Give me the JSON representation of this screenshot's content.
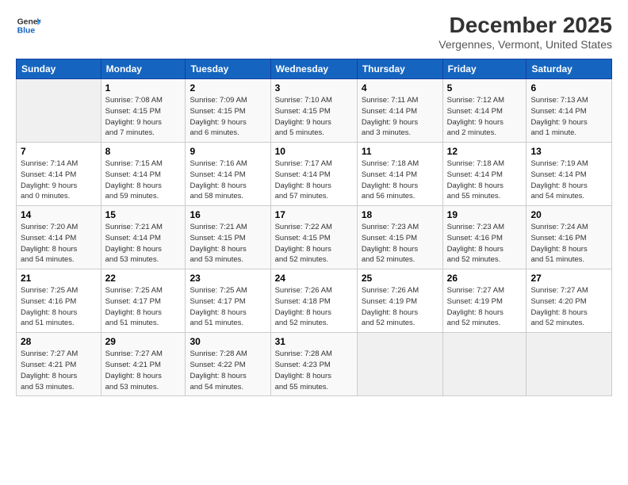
{
  "logo": {
    "line1": "General",
    "line2": "Blue"
  },
  "title": "December 2025",
  "subtitle": "Vergennes, Vermont, United States",
  "header_days": [
    "Sunday",
    "Monday",
    "Tuesday",
    "Wednesday",
    "Thursday",
    "Friday",
    "Saturday"
  ],
  "weeks": [
    [
      {
        "day": "",
        "info": ""
      },
      {
        "day": "1",
        "info": "Sunrise: 7:08 AM\nSunset: 4:15 PM\nDaylight: 9 hours\nand 7 minutes."
      },
      {
        "day": "2",
        "info": "Sunrise: 7:09 AM\nSunset: 4:15 PM\nDaylight: 9 hours\nand 6 minutes."
      },
      {
        "day": "3",
        "info": "Sunrise: 7:10 AM\nSunset: 4:15 PM\nDaylight: 9 hours\nand 5 minutes."
      },
      {
        "day": "4",
        "info": "Sunrise: 7:11 AM\nSunset: 4:14 PM\nDaylight: 9 hours\nand 3 minutes."
      },
      {
        "day": "5",
        "info": "Sunrise: 7:12 AM\nSunset: 4:14 PM\nDaylight: 9 hours\nand 2 minutes."
      },
      {
        "day": "6",
        "info": "Sunrise: 7:13 AM\nSunset: 4:14 PM\nDaylight: 9 hours\nand 1 minute."
      }
    ],
    [
      {
        "day": "7",
        "info": "Sunrise: 7:14 AM\nSunset: 4:14 PM\nDaylight: 9 hours\nand 0 minutes."
      },
      {
        "day": "8",
        "info": "Sunrise: 7:15 AM\nSunset: 4:14 PM\nDaylight: 8 hours\nand 59 minutes."
      },
      {
        "day": "9",
        "info": "Sunrise: 7:16 AM\nSunset: 4:14 PM\nDaylight: 8 hours\nand 58 minutes."
      },
      {
        "day": "10",
        "info": "Sunrise: 7:17 AM\nSunset: 4:14 PM\nDaylight: 8 hours\nand 57 minutes."
      },
      {
        "day": "11",
        "info": "Sunrise: 7:18 AM\nSunset: 4:14 PM\nDaylight: 8 hours\nand 56 minutes."
      },
      {
        "day": "12",
        "info": "Sunrise: 7:18 AM\nSunset: 4:14 PM\nDaylight: 8 hours\nand 55 minutes."
      },
      {
        "day": "13",
        "info": "Sunrise: 7:19 AM\nSunset: 4:14 PM\nDaylight: 8 hours\nand 54 minutes."
      }
    ],
    [
      {
        "day": "14",
        "info": "Sunrise: 7:20 AM\nSunset: 4:14 PM\nDaylight: 8 hours\nand 54 minutes."
      },
      {
        "day": "15",
        "info": "Sunrise: 7:21 AM\nSunset: 4:14 PM\nDaylight: 8 hours\nand 53 minutes."
      },
      {
        "day": "16",
        "info": "Sunrise: 7:21 AM\nSunset: 4:15 PM\nDaylight: 8 hours\nand 53 minutes."
      },
      {
        "day": "17",
        "info": "Sunrise: 7:22 AM\nSunset: 4:15 PM\nDaylight: 8 hours\nand 52 minutes."
      },
      {
        "day": "18",
        "info": "Sunrise: 7:23 AM\nSunset: 4:15 PM\nDaylight: 8 hours\nand 52 minutes."
      },
      {
        "day": "19",
        "info": "Sunrise: 7:23 AM\nSunset: 4:16 PM\nDaylight: 8 hours\nand 52 minutes."
      },
      {
        "day": "20",
        "info": "Sunrise: 7:24 AM\nSunset: 4:16 PM\nDaylight: 8 hours\nand 51 minutes."
      }
    ],
    [
      {
        "day": "21",
        "info": "Sunrise: 7:25 AM\nSunset: 4:16 PM\nDaylight: 8 hours\nand 51 minutes."
      },
      {
        "day": "22",
        "info": "Sunrise: 7:25 AM\nSunset: 4:17 PM\nDaylight: 8 hours\nand 51 minutes."
      },
      {
        "day": "23",
        "info": "Sunrise: 7:25 AM\nSunset: 4:17 PM\nDaylight: 8 hours\nand 51 minutes."
      },
      {
        "day": "24",
        "info": "Sunrise: 7:26 AM\nSunset: 4:18 PM\nDaylight: 8 hours\nand 52 minutes."
      },
      {
        "day": "25",
        "info": "Sunrise: 7:26 AM\nSunset: 4:19 PM\nDaylight: 8 hours\nand 52 minutes."
      },
      {
        "day": "26",
        "info": "Sunrise: 7:27 AM\nSunset: 4:19 PM\nDaylight: 8 hours\nand 52 minutes."
      },
      {
        "day": "27",
        "info": "Sunrise: 7:27 AM\nSunset: 4:20 PM\nDaylight: 8 hours\nand 52 minutes."
      }
    ],
    [
      {
        "day": "28",
        "info": "Sunrise: 7:27 AM\nSunset: 4:21 PM\nDaylight: 8 hours\nand 53 minutes."
      },
      {
        "day": "29",
        "info": "Sunrise: 7:27 AM\nSunset: 4:21 PM\nDaylight: 8 hours\nand 53 minutes."
      },
      {
        "day": "30",
        "info": "Sunrise: 7:28 AM\nSunset: 4:22 PM\nDaylight: 8 hours\nand 54 minutes."
      },
      {
        "day": "31",
        "info": "Sunrise: 7:28 AM\nSunset: 4:23 PM\nDaylight: 8 hours\nand 55 minutes."
      },
      {
        "day": "",
        "info": ""
      },
      {
        "day": "",
        "info": ""
      },
      {
        "day": "",
        "info": ""
      }
    ]
  ]
}
